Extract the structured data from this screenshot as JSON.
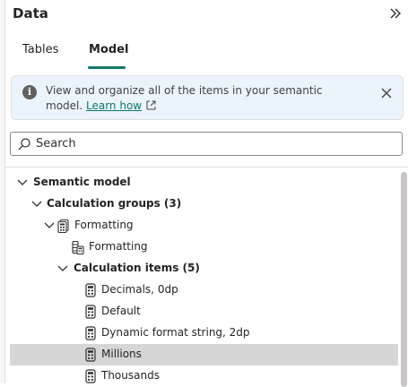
{
  "pane": {
    "title": "Data",
    "collapse_icon": "double-chevron-right-icon"
  },
  "tabs": [
    {
      "label": "Tables",
      "selected": false
    },
    {
      "label": "Model",
      "selected": true
    }
  ],
  "accent_color": "#117865",
  "info": {
    "icon": "info-icon",
    "text": "View and organize all of the items in your semantic model. ",
    "link_label": "Learn how",
    "link_icon": "external-link-icon",
    "close_icon": "dismiss-icon"
  },
  "search": {
    "placeholder": "Search",
    "value": "",
    "icon": "search-icon"
  },
  "tree": {
    "items": [
      {
        "label": "Semantic model",
        "level": 0,
        "expanded": true,
        "icon": "",
        "bold": true
      },
      {
        "label": "Calculation groups (3)",
        "level": 1,
        "expanded": true,
        "icon": "",
        "bold": true
      },
      {
        "label": "Formatting",
        "level": 2,
        "expanded": true,
        "icon": "calculation-group-icon",
        "bold": false
      },
      {
        "label": "Formatting",
        "level": 3,
        "icon": "calculation-column-icon",
        "bold": false
      },
      {
        "label": "Calculation items (5)",
        "level": 3,
        "expanded": true,
        "icon": "",
        "bold": true
      },
      {
        "label": "Decimals, 0dp",
        "level": 4,
        "icon": "calculation-item-icon",
        "bold": false
      },
      {
        "label": "Default",
        "level": 4,
        "icon": "calculation-item-icon",
        "bold": false
      },
      {
        "label": "Dynamic format string, 2dp",
        "level": 4,
        "icon": "calculation-item-icon",
        "bold": false
      },
      {
        "label": "Millions",
        "level": 4,
        "icon": "calculation-item-icon",
        "bold": false,
        "selected": true
      },
      {
        "label": "Thousands",
        "level": 4,
        "icon": "calculation-item-icon",
        "bold": false
      }
    ]
  }
}
